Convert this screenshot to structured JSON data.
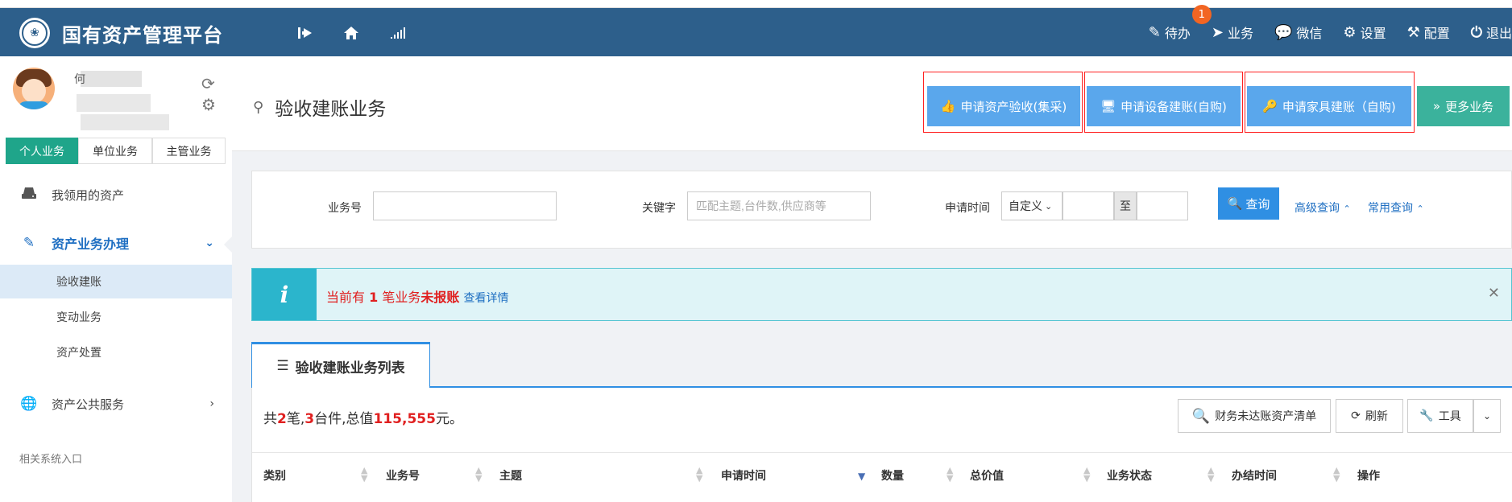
{
  "topbar": {
    "title": "国有资产管理平台",
    "nav_icons": [
      "collapse-sidebar-icon",
      "home-icon",
      "signal-icon"
    ],
    "actions": [
      {
        "label": "待办",
        "icon": "edit-icon",
        "badge": "1"
      },
      {
        "label": "业务",
        "icon": "send-icon"
      },
      {
        "label": "微信",
        "icon": "wechat-icon"
      },
      {
        "label": "设置",
        "icon": "gear-icon"
      },
      {
        "label": "配置",
        "icon": "tools-icon"
      },
      {
        "label": "退出",
        "icon": "power-icon"
      }
    ]
  },
  "sidebar": {
    "user_name": "何",
    "tabs": [
      "个人业务",
      "单位业务",
      "主管业务"
    ],
    "menu": [
      {
        "label": "我领用的资产",
        "icon": "drive-icon"
      },
      {
        "label": "资产业务办理",
        "icon": "pencil-icon",
        "expanded": true
      },
      {
        "label": "资产公共服务",
        "icon": "globe-icon"
      }
    ],
    "submenu": [
      "验收建账",
      "变动业务",
      "资产处置"
    ],
    "caption": "相关系统入口"
  },
  "header": {
    "page_title": "验收建账业务",
    "buttons": [
      {
        "label": "申请资产验收(集采)",
        "icon": "thumbs-up-icon"
      },
      {
        "label": "申请设备建账(自购)",
        "icon": "monitor-icon"
      },
      {
        "label": "申请家具建账（自购)",
        "icon": "key-icon"
      },
      {
        "label": "更多业务",
        "icon": "double-chevron-right-icon"
      }
    ]
  },
  "search": {
    "biz_no_label": "业务号",
    "biz_no_value": "",
    "keyword_label": "关键字",
    "keyword_placeholder": "匹配主题,台件数,供应商等",
    "time_label": "申请时间",
    "time_mode": "自定义",
    "to_label": "至",
    "date_from": "",
    "date_to": "",
    "query_button": "查询",
    "advanced_link": "高级查询",
    "common_link": "常用查询"
  },
  "alert": {
    "prefix": "当前有",
    "count": "1",
    "middle": "笔业务",
    "emphasis": "未报账",
    "link": "查看详情"
  },
  "list": {
    "tab_label": "验收建账业务列表",
    "summary": {
      "p1": "共",
      "count": "2",
      "p2": "笔,",
      "items": "3",
      "p3": "台件,总值",
      "total": "115,555",
      "p4": "元。"
    },
    "toolbar": {
      "unreconciled": "财务未达账资产清单",
      "refresh": "刷新",
      "tools": "工具"
    },
    "columns": [
      "类别",
      "业务号",
      "主题",
      "申请时间",
      "数量",
      "总价值",
      "业务状态",
      "办结时间",
      "操作"
    ]
  },
  "colors": {
    "topbar": "#2d5f8b",
    "accent_blue": "#2f8fe3",
    "button_blue": "#5aa7ec",
    "teal": "#3bb29c",
    "highlight_red": "#e02020"
  }
}
